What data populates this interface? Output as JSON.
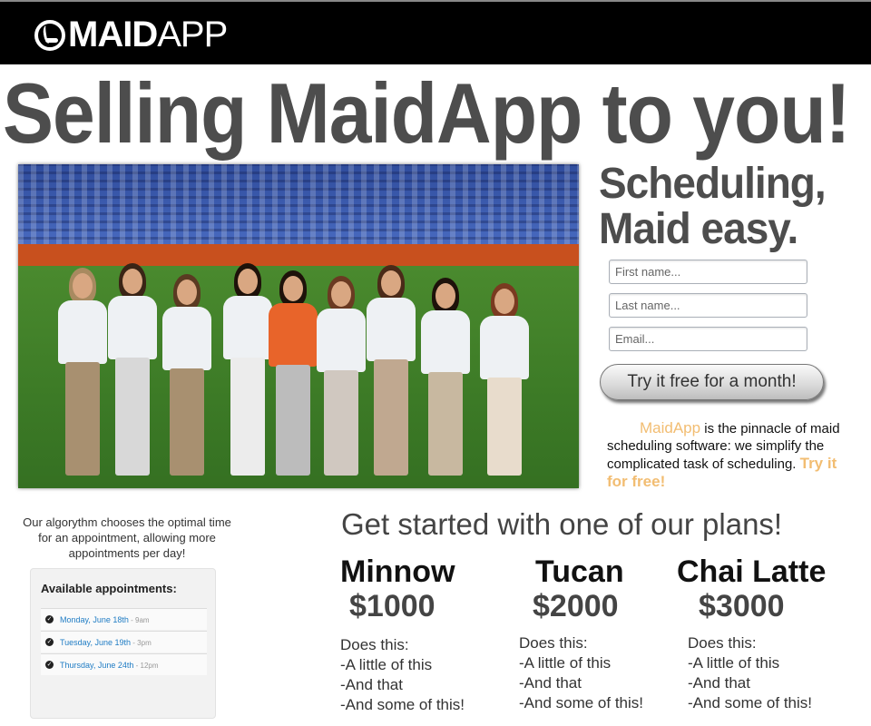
{
  "header": {
    "logo_bold": "MAID",
    "logo_light": "APP",
    "logo_icon": "maid-logo-icon"
  },
  "headline": "Selling MaidApp to you!",
  "hero": {
    "image_alt": "team photo on football field",
    "tagline_line1": "Scheduling,",
    "tagline_line2": "Maid easy."
  },
  "signup": {
    "first_name_placeholder": "First name...",
    "last_name_placeholder": "Last name...",
    "email_placeholder": "Email...",
    "cta_label": "Try it free for a month!"
  },
  "pitch": {
    "brand": "MaidApp",
    "body": " is the pinnacle of maid scheduling software: we simplify the complicated task of scheduling. ",
    "free_link": "Try it for free!",
    "accent_color": "#f2bd72"
  },
  "appointments": {
    "intro": "Our algorythm chooses the optimal time for an appointment, allowing more appointments per day!",
    "title": "Available appointments:",
    "items": [
      {
        "day": "Monday, June 18th",
        "time": " - 9am"
      },
      {
        "day": "Tuesday, June 19th",
        "time": " - 3pm"
      },
      {
        "day": "Thursday, June 24th",
        "time": " - 12pm"
      }
    ]
  },
  "plans": {
    "heading": "Get started with one of our plans!",
    "items": [
      {
        "name": "Minnow",
        "price": "$1000",
        "features": [
          "Does this:",
          "-A little of this",
          "-And that",
          "-And some of this!"
        ]
      },
      {
        "name": "Tucan",
        "price": "$2000",
        "features": [
          "Does this:",
          "-A little of this",
          "-And that",
          "-And some of this!"
        ]
      },
      {
        "name": "Chai Latte",
        "price": "$3000",
        "features": [
          "Does this:",
          "-A little of this",
          "-And that",
          "-And some of this!"
        ]
      }
    ]
  }
}
